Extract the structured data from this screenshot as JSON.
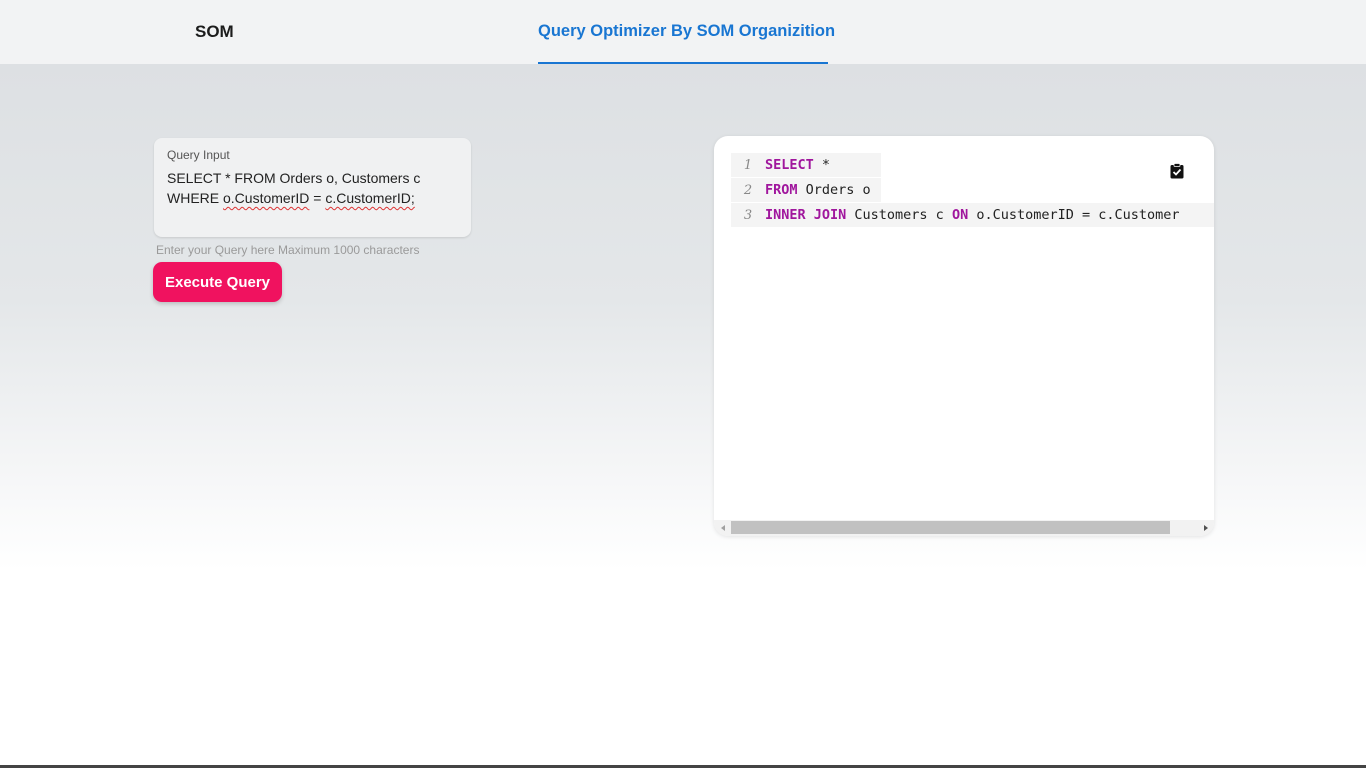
{
  "header": {
    "brand": "SOM",
    "tabs": [
      {
        "label": "Query Optimizer By SOM Organizition",
        "active": true
      }
    ],
    "accent_color": "#1976d2"
  },
  "query_input": {
    "label": "Query Input",
    "line1": "SELECT * FROM Orders o, Customers c",
    "line2_prefix": "WHERE ",
    "line2_col1": "o.CustomerID",
    "line2_mid": " = ",
    "line2_col2": "c.CustomerID;",
    "helper_text": "Enter your Query here Maximum 1000 characters"
  },
  "execute_button": {
    "label": "Execute Query",
    "color": "#f0125f"
  },
  "output": {
    "lines": [
      {
        "number": "1",
        "kw1": "SELECT",
        "rest1": " *"
      },
      {
        "number": "2",
        "kw1": "FROM",
        "rest1": " Orders o"
      },
      {
        "number": "3",
        "kw1": "INNER JOIN",
        "rest1": " Customers c ",
        "kw2": "ON",
        "rest2": " o.CustomerID = c.Customer"
      }
    ],
    "copy_icon": "clipboard-check-icon",
    "keyword_color": "#a0169d"
  }
}
